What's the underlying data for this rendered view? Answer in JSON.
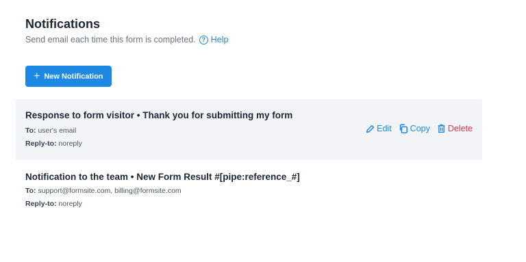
{
  "header": {
    "title": "Notifications",
    "subtitle": "Send email each time this form is completed.",
    "help_label": "Help"
  },
  "new_button": {
    "label": "New Notification"
  },
  "notifications": [
    {
      "title": "Response to form visitor • Thank you for submitting my form",
      "to_label": "To:",
      "to": "user's email",
      "reply_label": "Reply-to:",
      "reply": "noreply"
    },
    {
      "title": "Notification to the team • New Form Result #[pipe:reference_#]",
      "to_label": "To:",
      "to": "support@formsite.com, billing@formsite.com",
      "reply_label": "Reply-to:",
      "reply": "noreply"
    }
  ],
  "actions": {
    "edit": "Edit",
    "copy": "Copy",
    "delete": "Delete"
  },
  "colors": {
    "accent": "#1e88e5",
    "danger": "#dc3545",
    "row_hover": "#f2f4f8"
  },
  "icons": [
    "help-icon",
    "plus-icon",
    "pencil-icon",
    "copy-icon",
    "trash-icon"
  ]
}
